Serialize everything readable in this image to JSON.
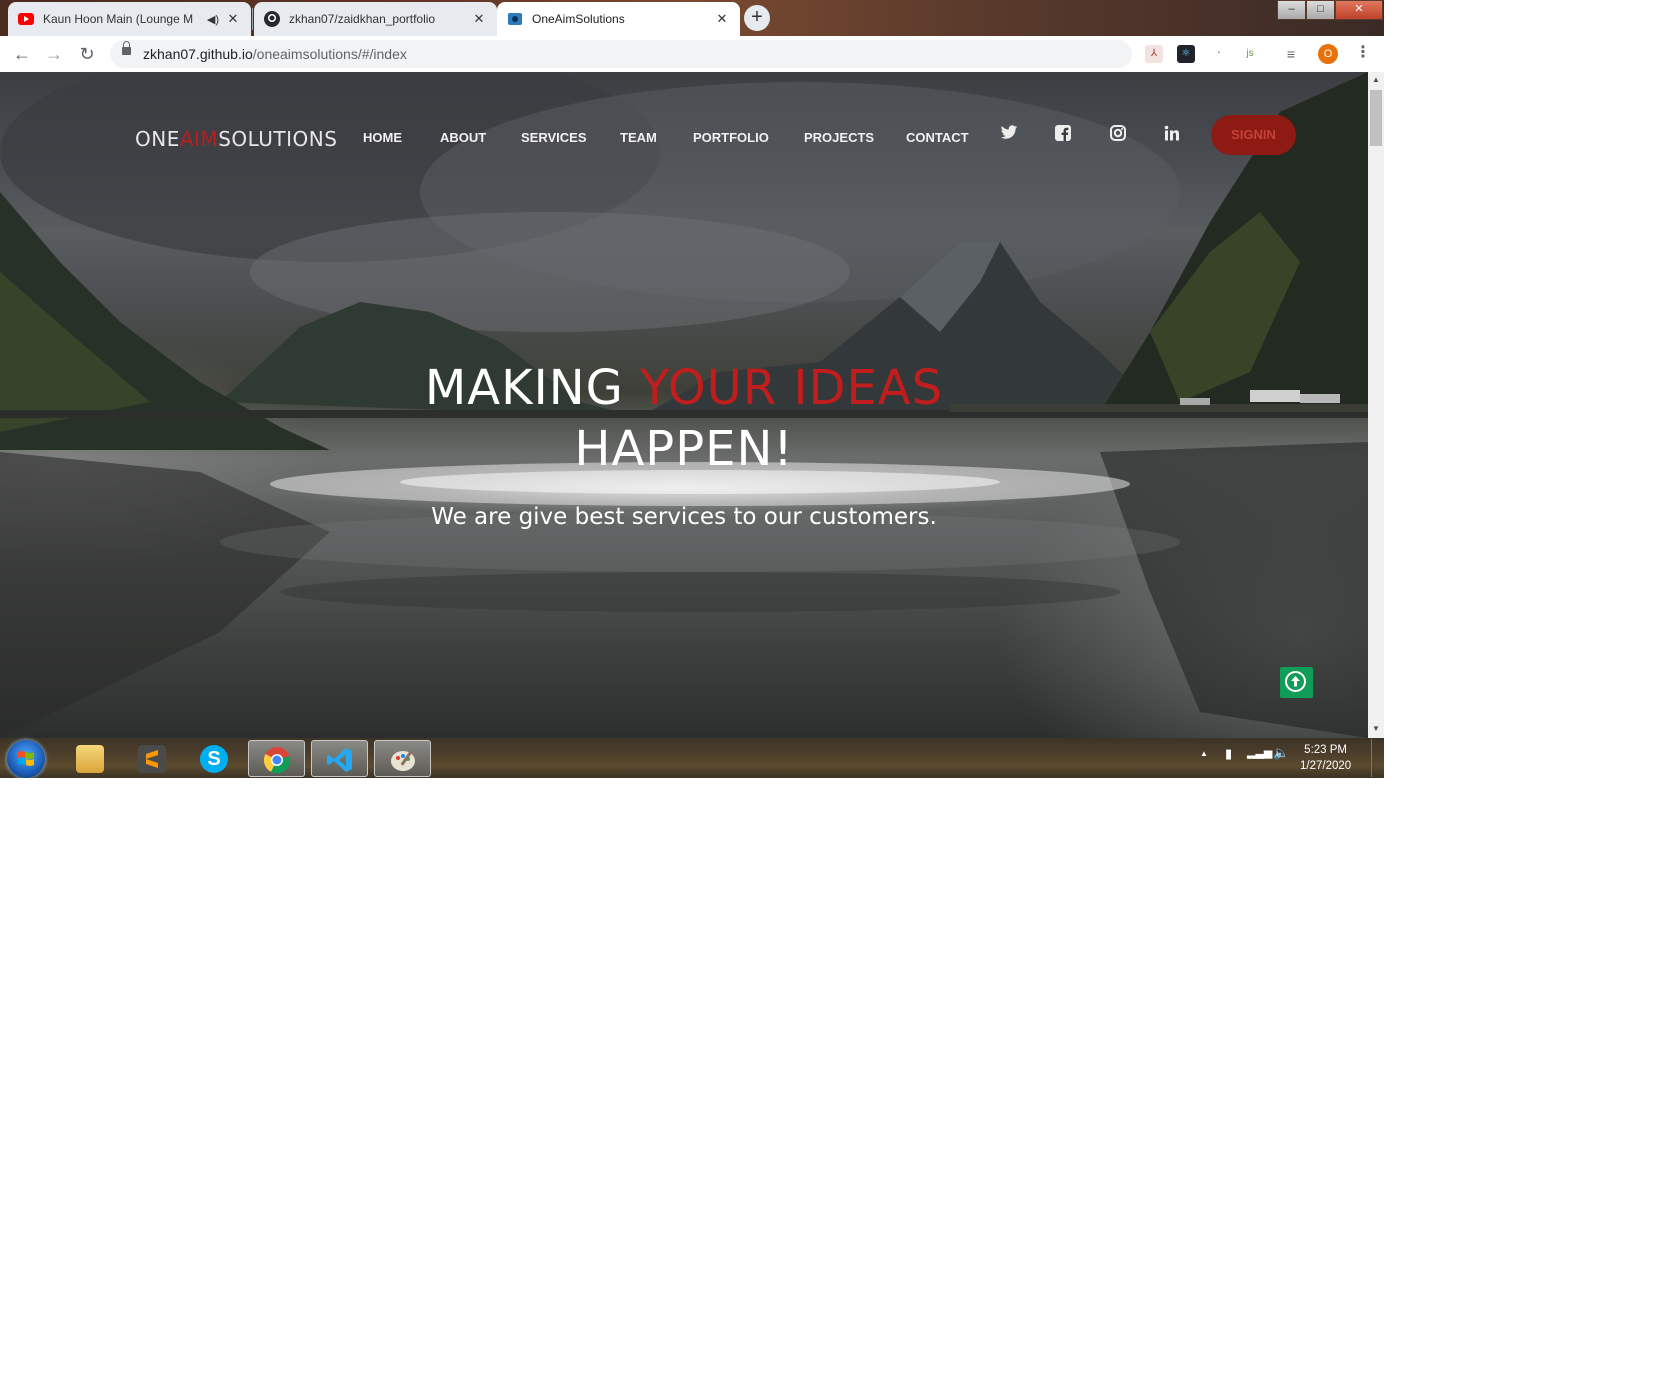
{
  "browser": {
    "tabs": [
      {
        "title": "Kaun Hoon Main (Lounge M",
        "icon": "youtube-icon",
        "audio": true,
        "active": false
      },
      {
        "title": "zkhan07/zaidkhan_portfolio",
        "icon": "github-icon",
        "active": false
      },
      {
        "title": "OneAimSolutions",
        "icon": "site-favicon",
        "active": true
      }
    ],
    "new_tab_label": "+",
    "address_host": "zkhan07.github.io",
    "address_path": "/oneaimsolutions/#/index",
    "avatar_letter": "O",
    "window_controls": {
      "minimize": "–",
      "maximize": "□",
      "close": "✕"
    }
  },
  "site": {
    "logo": {
      "part1": "ONE",
      "part2": "AIM",
      "part3": "SOLUTIONS"
    },
    "nav": [
      {
        "label": "HOME"
      },
      {
        "label": "ABOUT"
      },
      {
        "label": "SERVICES"
      },
      {
        "label": "TEAM"
      },
      {
        "label": "PORTFOLIO"
      },
      {
        "label": "PROJECTS"
      },
      {
        "label": "CONTACT"
      }
    ],
    "social_icons": [
      "twitter-icon",
      "facebook-icon",
      "instagram-icon",
      "linkedin-icon"
    ],
    "signin_label": "SIGNIN",
    "hero": {
      "title_part1": "MAKING ",
      "title_accent": "YOUR IDEAS",
      "title_part2": "HAPPEN!",
      "subtitle": "We are give best services to our customers."
    },
    "colors": {
      "accent": "#c21d1d",
      "signin_bg": "#8e1a14",
      "scroll_button": "#0f9d58"
    }
  },
  "taskbar": {
    "apps": [
      "windows-explorer-icon",
      "sublime-text-icon",
      "skype-icon",
      "chrome-icon",
      "vscode-icon",
      "paint-icon"
    ],
    "time": "5:23 PM",
    "date": "1/27/2020"
  }
}
